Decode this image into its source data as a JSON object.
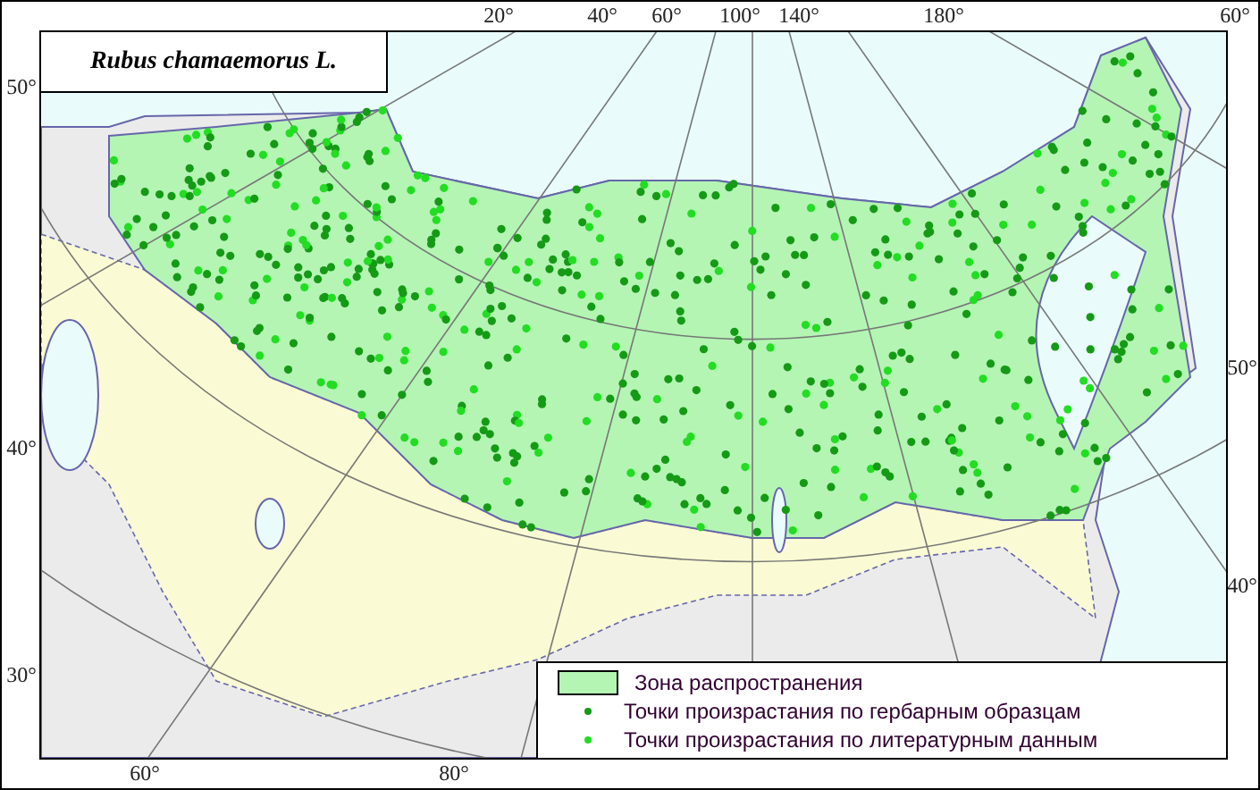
{
  "title": "Rubus chamaemorus L.",
  "graticule_labels": {
    "top": [
      "20°",
      "40°",
      "60°",
      "100°",
      "140°",
      "180°",
      "60°"
    ],
    "left": [
      "50°",
      "40°",
      "30°"
    ],
    "right": [
      "50°",
      "40°"
    ],
    "bottom": [
      "60°",
      "80°"
    ]
  },
  "legend": [
    {
      "kind": "zone",
      "label": "Зона распространения",
      "color": "#b4f5b4"
    },
    {
      "kind": "herbarium_point",
      "label": "Точки произрастания по гербарным образцам",
      "color": "#159a15"
    },
    {
      "kind": "literature_point",
      "label": "Точки произрастания по литературным данным",
      "color": "#22dd22"
    }
  ]
}
